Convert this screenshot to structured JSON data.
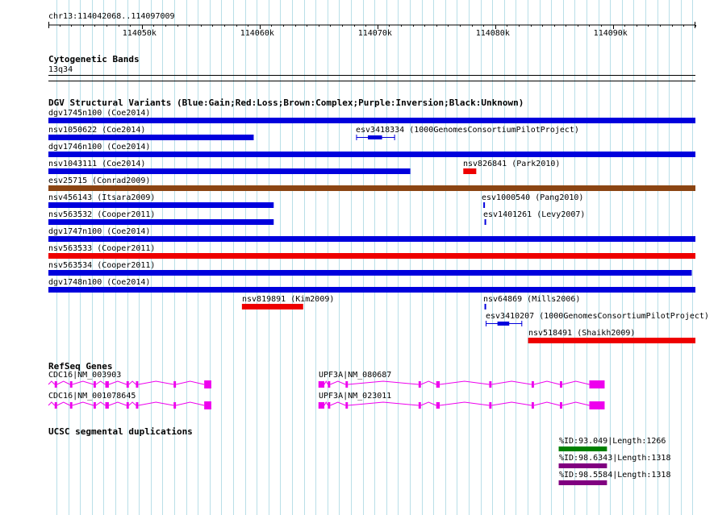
{
  "ruler": {
    "region": "chr13:114042068..114097009",
    "start": 114042068,
    "end": 114097009,
    "ticks": [
      {
        "pos": 114050000,
        "label": "114050k"
      },
      {
        "pos": 114060000,
        "label": "114060k"
      },
      {
        "pos": 114070000,
        "label": "114070k"
      },
      {
        "pos": 114080000,
        "label": "114080k"
      },
      {
        "pos": 114090000,
        "label": "114090k"
      }
    ]
  },
  "cytoband": {
    "title": "Cytogenetic Bands",
    "band": "13q34"
  },
  "dgv": {
    "title": "DGV Structural Variants (Blue:Gain;Red:Loss;Brown:Complex;Purple:Inversion;Black:Unknown)",
    "colors": {
      "gain": "#0000dd",
      "loss": "#ee0000",
      "complex": "#8b4513",
      "inversion": "#800080",
      "unknown": "#000000"
    },
    "variants": [
      {
        "id": "dgv1745n100",
        "label": "dgv1745n100 (Coe2014)",
        "type": "gain",
        "start": 114042068,
        "end": 114097009
      },
      {
        "id": "nsv1050622",
        "label": "nsv1050622 (Coe2014)",
        "type": "gain",
        "start": 114042068,
        "end": 114059500
      },
      {
        "id": "esv3418334",
        "label": "esv3418334 (1000GenomesConsortiumPilotProject)",
        "type": "gain",
        "start": 114068200,
        "end": 114071500,
        "style": "gapped",
        "inner": [
          114069200,
          114070400
        ]
      },
      {
        "id": "dgv1746n100",
        "label": "dgv1746n100 (Coe2014)",
        "type": "gain",
        "start": 114042068,
        "end": 114097009
      },
      {
        "id": "nsv1043111",
        "label": "nsv1043111 (Coe2014)",
        "type": "gain",
        "start": 114042068,
        "end": 114072800
      },
      {
        "id": "nsv826841",
        "label": "nsv826841 (Park2010)",
        "type": "loss",
        "start": 114077300,
        "end": 114078400
      },
      {
        "id": "esv25715",
        "label": "esv25715 (Conrad2009)",
        "type": "complex",
        "start": 114042068,
        "end": 114097009
      },
      {
        "id": "nsv456143",
        "label": "nsv456143 (Itsara2009)",
        "type": "gain",
        "start": 114042068,
        "end": 114061200
      },
      {
        "id": "esv1000540",
        "label": "esv1000540 (Pang2010)",
        "type": "gain",
        "start": 114079000,
        "end": 114079100
      },
      {
        "id": "nsv563532",
        "label": "nsv563532 (Cooper2011)",
        "type": "gain",
        "start": 114042068,
        "end": 114061200
      },
      {
        "id": "esv1401261",
        "label": "esv1401261 (Levy2007)",
        "type": "gain",
        "start": 114079100,
        "end": 114079200
      },
      {
        "id": "dgv1747n100",
        "label": "dgv1747n100 (Coe2014)",
        "type": "gain",
        "start": 114042068,
        "end": 114097009
      },
      {
        "id": "nsv563533",
        "label": "nsv563533 (Cooper2011)",
        "type": "loss",
        "start": 114042068,
        "end": 114097009
      },
      {
        "id": "nsv563534",
        "label": "nsv563534 (Cooper2011)",
        "type": "gain",
        "start": 114042068,
        "end": 114096700
      },
      {
        "id": "dgv1748n100",
        "label": "dgv1748n100 (Coe2014)",
        "type": "gain",
        "start": 114042068,
        "end": 114097009
      },
      {
        "id": "nsv819891",
        "label": "nsv819891 (Kim2009)",
        "type": "loss",
        "start": 114058500,
        "end": 114063700
      },
      {
        "id": "nsv64869",
        "label": "nsv64869 (Mills2006)",
        "type": "gain",
        "start": 114079100,
        "end": 114079200
      },
      {
        "id": "esv3410207",
        "label": "esv3410207 (1000GenomesConsortiumPilotProject)",
        "type": "gain",
        "start": 114079200,
        "end": 114082300,
        "style": "gapped",
        "inner": [
          114080200,
          114081200
        ]
      },
      {
        "id": "nsv518491",
        "label": "nsv518491 (Shaikh2009)",
        "type": "loss",
        "start": 114082800,
        "end": 114097009
      }
    ]
  },
  "refseq": {
    "title": "RefSeq Genes",
    "color": "#ee00ee",
    "genes": [
      {
        "label": "CDC16|NM_003903",
        "strand": "+",
        "start": 114042068,
        "end": 114056000,
        "exons": [
          [
            114042600,
            114042800
          ],
          [
            114043900,
            114044100
          ],
          [
            114045900,
            114046100
          ],
          [
            114046900,
            114047200
          ],
          [
            114048700,
            114048900
          ],
          [
            114049500,
            114049700
          ],
          [
            114052700,
            114052900
          ],
          [
            114055300,
            114055900
          ]
        ]
      },
      {
        "label": "CDC16|NM_001078645",
        "strand": "+",
        "start": 114042068,
        "end": 114056000,
        "exons": [
          [
            114042600,
            114042800
          ],
          [
            114043900,
            114044100
          ],
          [
            114045900,
            114046100
          ],
          [
            114046900,
            114047200
          ],
          [
            114048700,
            114048900
          ],
          [
            114049500,
            114049700
          ],
          [
            114052700,
            114052900
          ],
          [
            114055300,
            114055900
          ]
        ]
      },
      {
        "label": "UPF3A|NM_080687",
        "strand": "+",
        "start": 114065000,
        "end": 114089300,
        "exons": [
          [
            114065000,
            114065500
          ],
          [
            114065800,
            114066000
          ],
          [
            114067300,
            114067500
          ],
          [
            114073500,
            114073700
          ],
          [
            114075000,
            114075300
          ],
          [
            114079500,
            114079700
          ],
          [
            114083100,
            114083300
          ],
          [
            114085500,
            114085700
          ],
          [
            114088000,
            114089300
          ]
        ]
      },
      {
        "label": "UPF3A|NM_023011",
        "strand": "+",
        "start": 114065000,
        "end": 114089300,
        "exons": [
          [
            114065000,
            114065500
          ],
          [
            114065800,
            114066000
          ],
          [
            114067300,
            114067500
          ],
          [
            114073500,
            114073700
          ],
          [
            114075000,
            114075300
          ],
          [
            114079500,
            114079700
          ],
          [
            114083100,
            114083300
          ],
          [
            114085500,
            114085700
          ],
          [
            114088000,
            114089300
          ]
        ]
      }
    ]
  },
  "segdups": {
    "title": "UCSC segmental duplications",
    "items": [
      {
        "label": "%ID:93.049|Length:1266",
        "color": "#008000",
        "start": 114085400,
        "end": 114089500
      },
      {
        "label": "%ID:98.6343|Length:1318",
        "color": "#800080",
        "start": 114085400,
        "end": 114089500
      },
      {
        "label": "%ID:98.5584|Length:1318",
        "color": "#800080",
        "start": 114085400,
        "end": 114089500
      }
    ]
  }
}
